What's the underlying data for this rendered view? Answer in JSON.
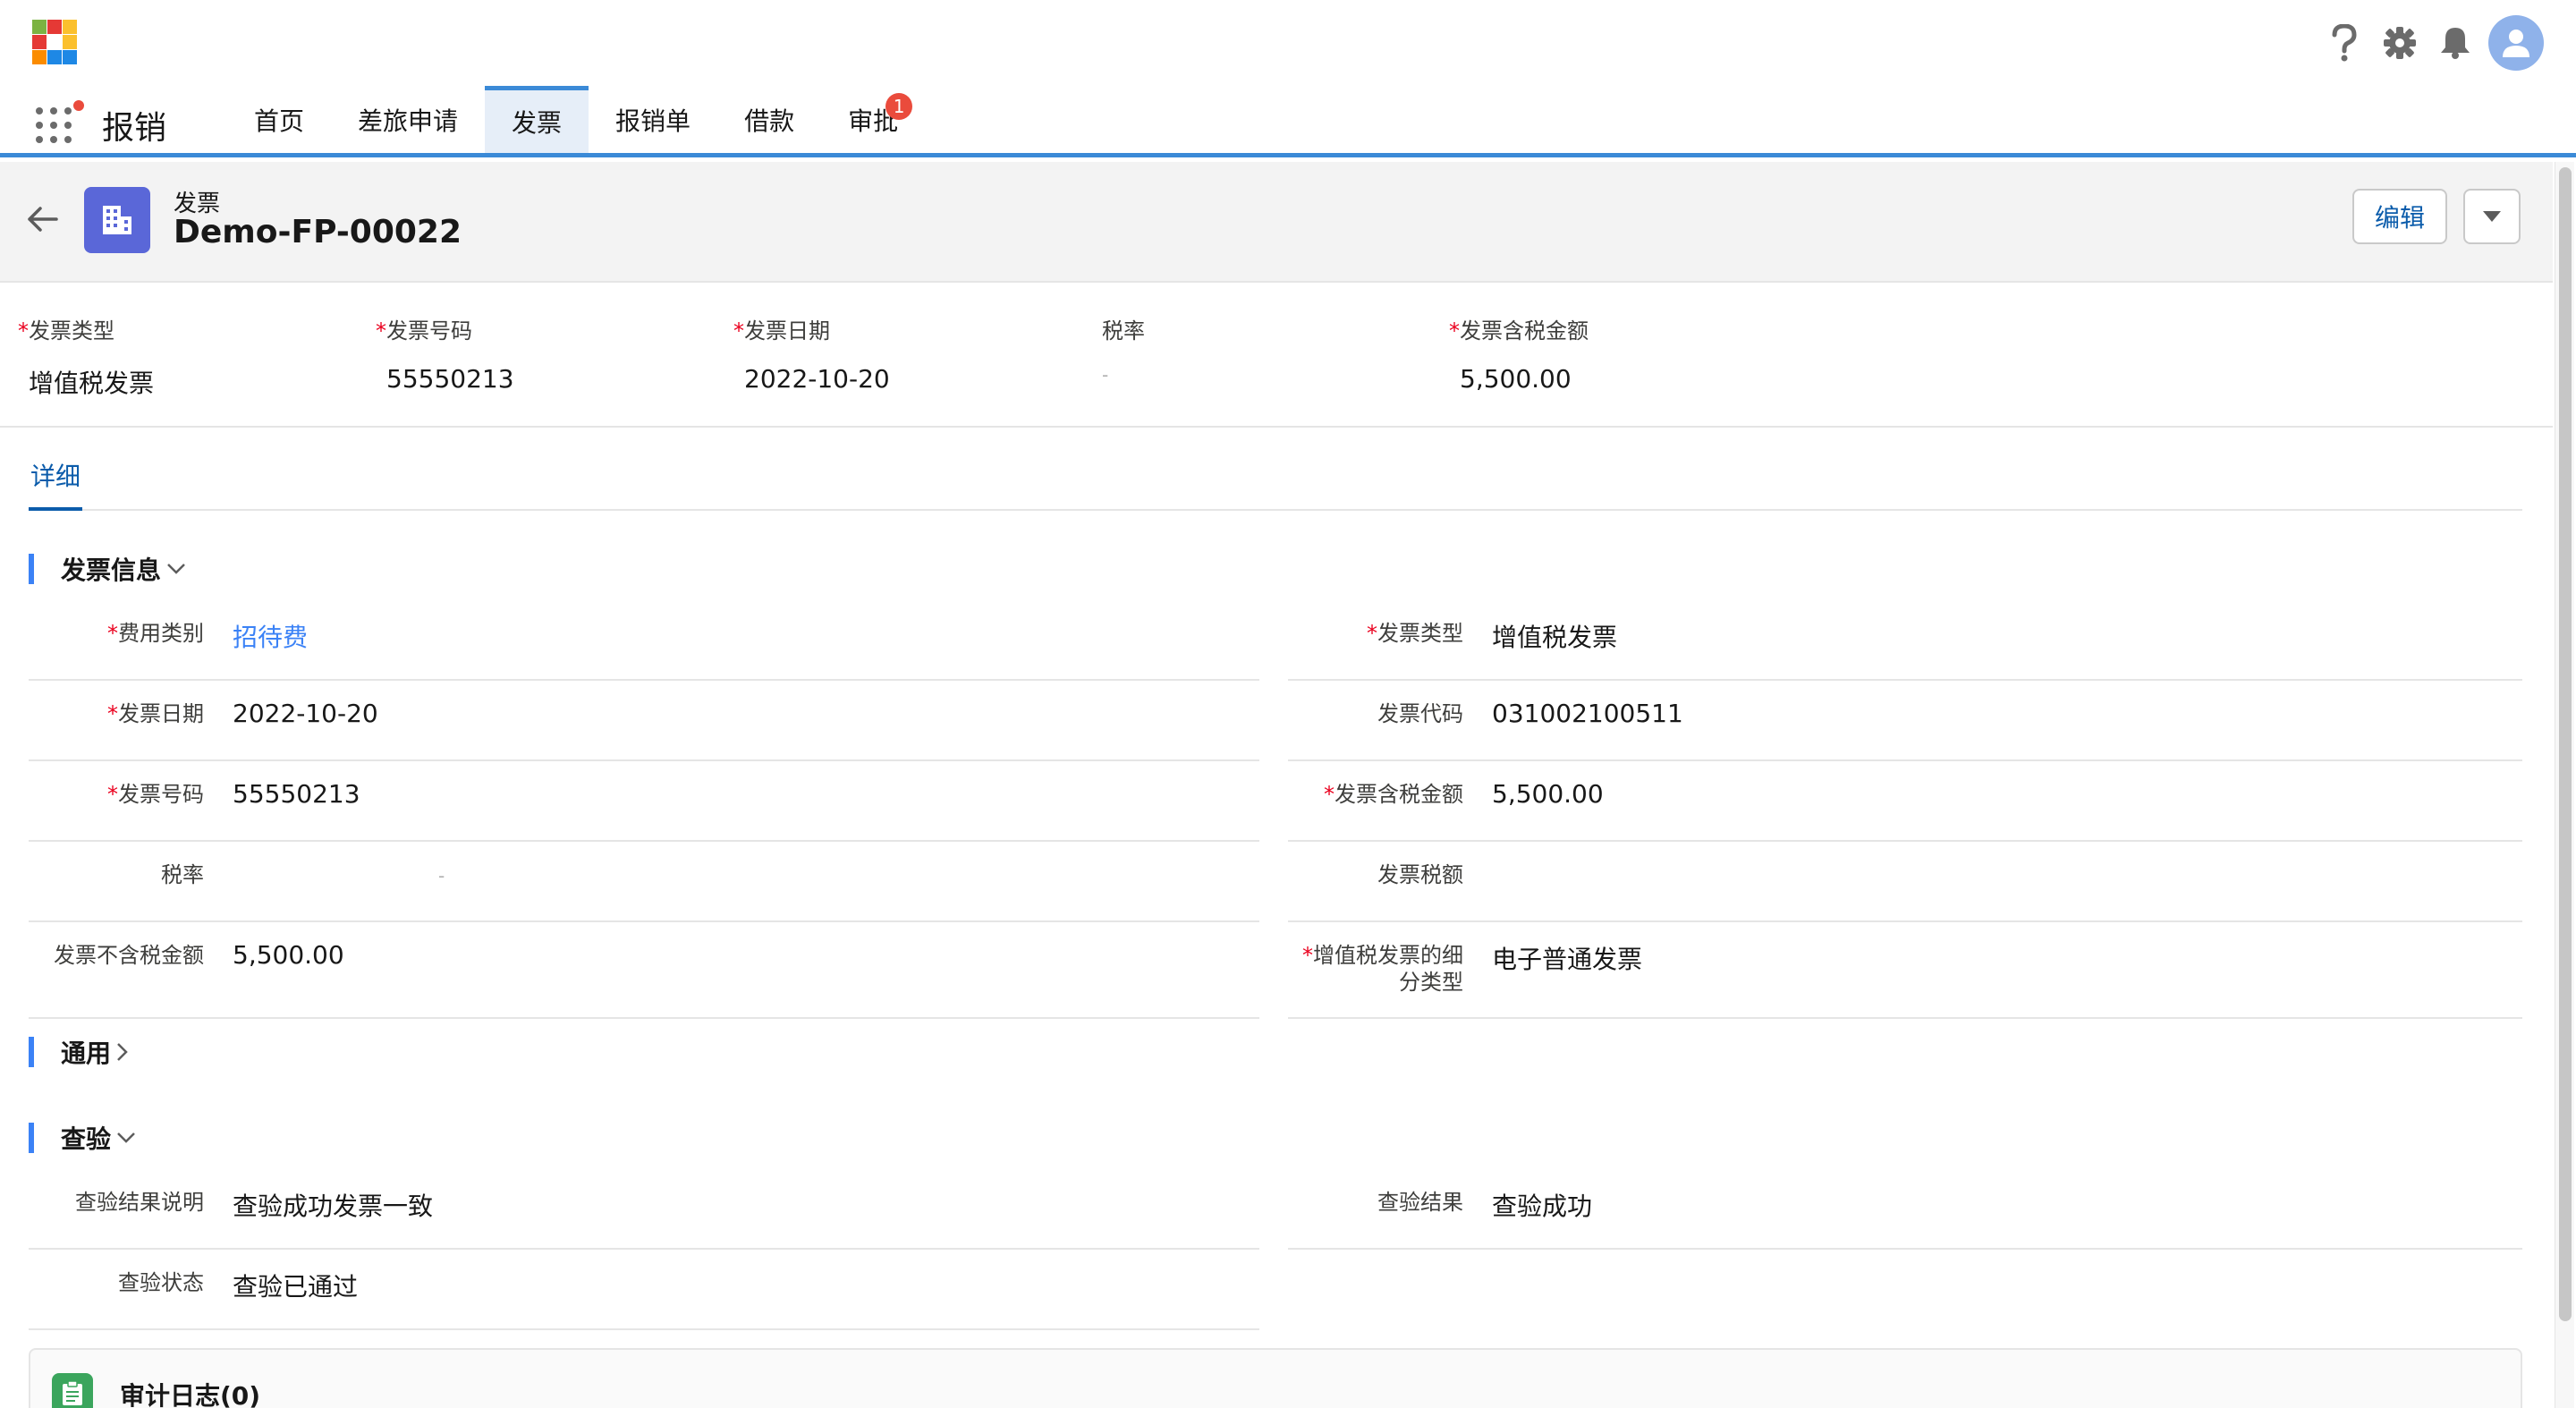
{
  "colors": {
    "accent": "#3b8ad7",
    "link": "#3b82f6",
    "required": "#ea001e",
    "badge": "#ea4b3c",
    "record_icon": "#5a67d8",
    "audit_icon": "#3ba55d"
  },
  "header": {
    "logo_icon": "app-grid-logo",
    "utilities": [
      "help-icon",
      "gear-icon",
      "bell-icon",
      "avatar-icon"
    ]
  },
  "nav": {
    "app_name": "报销",
    "tabs": [
      {
        "label": "首页"
      },
      {
        "label": "差旅申请"
      },
      {
        "label": "发票",
        "active": true
      },
      {
        "label": "报销单"
      },
      {
        "label": "借款"
      },
      {
        "label": "审批",
        "badge": "1"
      }
    ]
  },
  "record": {
    "object_label": "发票",
    "title": "Demo-FP-00022",
    "edit_label": "编辑"
  },
  "highlights": [
    {
      "label": "发票类型",
      "value": "增值税发票",
      "required": true
    },
    {
      "label": "发票号码",
      "value": "55550213",
      "required": true
    },
    {
      "label": "发票日期",
      "value": "2022-10-20",
      "required": true
    },
    {
      "label": "税率",
      "value": "-",
      "required": false
    },
    {
      "label": "发票含税金额",
      "value": "5,500.00",
      "required": true
    }
  ],
  "detail_tab": "详细",
  "sections": {
    "invoice_info": {
      "title": "发票信息",
      "fields": [
        {
          "label": "费用类别",
          "value": "招待费",
          "required": true,
          "link": true
        },
        {
          "label": "发票类型",
          "value": "增值税发票",
          "required": true
        },
        {
          "label": "发票日期",
          "value": "2022-10-20",
          "required": true
        },
        {
          "label": "发票代码",
          "value": "031002100511",
          "required": false
        },
        {
          "label": "发票号码",
          "value": "55550213",
          "required": true
        },
        {
          "label": "发票含税金额",
          "value": "5,500.00",
          "required": true
        },
        {
          "label": "税率",
          "value": "-",
          "required": false
        },
        {
          "label": "发票税额",
          "value": "",
          "required": false
        },
        {
          "label": "发票不含税金额",
          "value": "5,500.00",
          "required": false
        },
        {
          "label": "增值税发票的细分类型",
          "value": "电子普通发票",
          "required": true
        }
      ]
    },
    "general": {
      "title": "通用"
    },
    "verification": {
      "title": "查验",
      "fields": [
        {
          "label": "查验结果说明",
          "value": "查验成功发票一致"
        },
        {
          "label": "查验结果",
          "value": "查验成功"
        },
        {
          "label": "查验状态",
          "value": "查验已通过"
        }
      ]
    }
  },
  "audit": {
    "title": "审计日志(0)"
  }
}
